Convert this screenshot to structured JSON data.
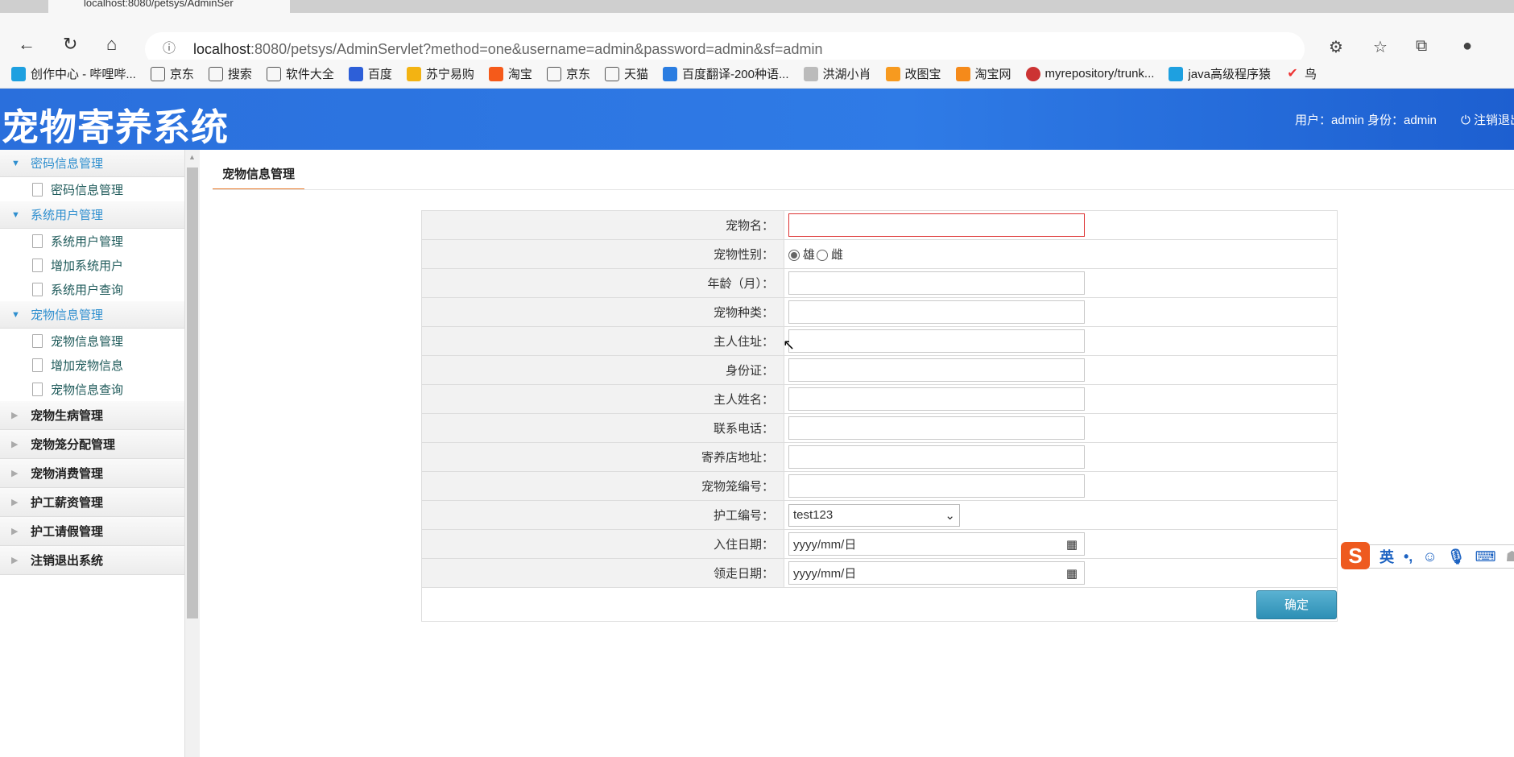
{
  "browser": {
    "tab_title": "localhost:8080/petsys/AdminSer",
    "url_host": "localhost",
    "url_rest": ":8080/petsys/AdminServlet?method=one&username=admin&password=admin&sf=admin"
  },
  "bookmarks": [
    "创作中心 - 哔哩哔...",
    "京东",
    "搜索",
    "软件大全",
    "百度",
    "苏宁易购",
    "淘宝",
    "京东",
    "天猫",
    "百度翻译-200种语...",
    "洪湖小肖",
    "改图宝",
    "淘宝网",
    "myrepository/trunk...",
    "java高级程序猿",
    "鸟"
  ],
  "header": {
    "title": "宠物寄养系统",
    "user_info": "用户：admin 身份：admin",
    "logout": "注销退出"
  },
  "sidebar": {
    "groups": [
      {
        "label": "密码信息管理",
        "items": [
          "密码信息管理"
        ]
      },
      {
        "label": "系统用户管理",
        "items": [
          "系统用户管理",
          "增加系统用户",
          "系统用户查询"
        ]
      },
      {
        "label": "宠物信息管理",
        "items": [
          "宠物信息管理",
          "增加宠物信息",
          "宠物信息查询"
        ]
      }
    ],
    "collapsed": [
      "宠物生病管理",
      "宠物笼分配管理",
      "宠物消费管理",
      "护工薪资管理",
      "护工请假管理",
      "注销退出系统"
    ]
  },
  "content": {
    "tab": "宠物信息管理"
  },
  "form": {
    "labels": {
      "name": "宠物名：",
      "sex": "宠物性别：",
      "age": "年龄（月）：",
      "type": "宠物种类：",
      "address": "主人住址：",
      "idcard": "身份证：",
      "owner": "主人姓名：",
      "phone": "联系电话：",
      "shop": "寄养店地址：",
      "cage": "宠物笼编号：",
      "worker": "护工编号：",
      "in_date": "入住日期：",
      "out_date": "领走日期："
    },
    "sex_options": [
      "雄",
      "雌"
    ],
    "worker_value": "test123",
    "date_placeholder": "yyyy/mm/日",
    "submit": "确定"
  },
  "ime": {
    "mode": "英"
  }
}
